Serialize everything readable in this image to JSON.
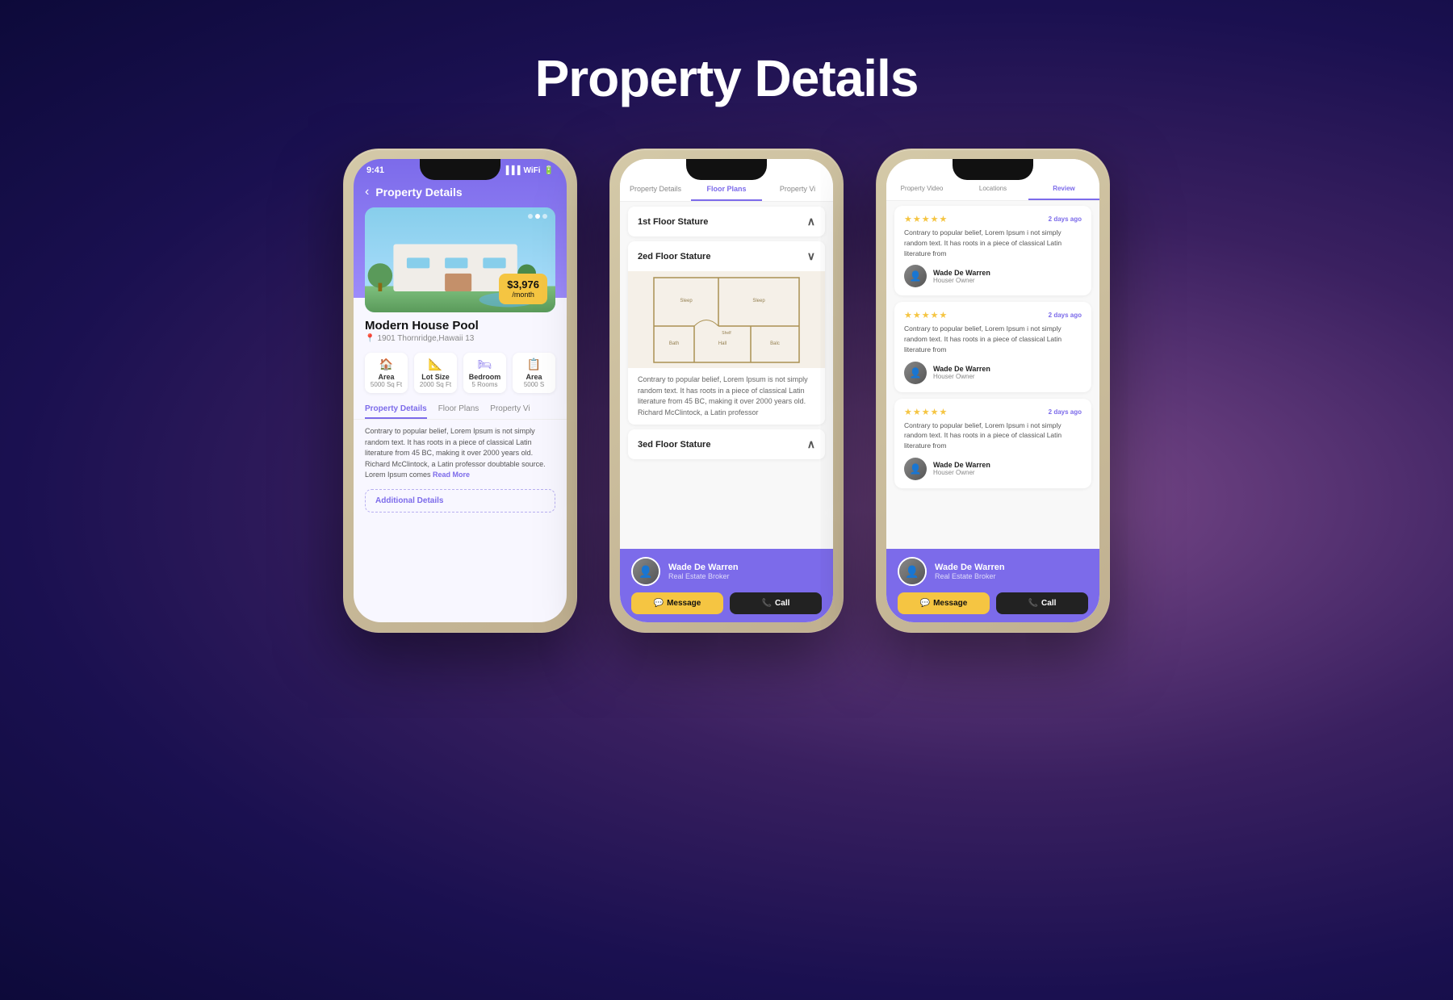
{
  "page": {
    "title": "Property Details",
    "background": "radial-gradient purple"
  },
  "phone1": {
    "status_time": "9:41",
    "header_title": "Property Details",
    "back_label": "‹",
    "property_name": "Modern House Pool",
    "property_address": "1901 Thornridge,Hawaii 13",
    "price": "$3,976",
    "price_period": "/month",
    "stats": [
      {
        "icon": "🏠",
        "label": "Area",
        "value": "5000 Sq Ft"
      },
      {
        "icon": "📐",
        "label": "Lot Size",
        "value": "2000 Sq Ft"
      },
      {
        "icon": "🛏",
        "label": "Bedroom",
        "value": "5 Rooms"
      },
      {
        "icon": "📋",
        "label": "Area",
        "value": "5000 S"
      }
    ],
    "tabs": [
      "Property Details",
      "Floor Plans",
      "Property Vi"
    ],
    "active_tab": "Property Details",
    "description": "Contrary to popular belief, Lorem Ipsum is not simply random text. It has roots in a piece of classical Latin literature from 45 BC, making it over 2000 years old. Richard McClintock, a Latin professor doubtable source. Lorem Ipsum comes",
    "read_more": "Read More",
    "additional_details": "Additional Details"
  },
  "phone2": {
    "tabs": [
      "Property Details",
      "Floor Plans",
      "Property Vi"
    ],
    "active_tab": "Floor Plans",
    "floors": [
      {
        "label": "1st Floor Stature",
        "expanded": false,
        "icon": "∧"
      },
      {
        "label": "2ed Floor Stature",
        "expanded": true,
        "icon": "∨",
        "description": "Contrary to popular belief, Lorem Ipsum is not simply random text. It has roots in a piece of classical Latin literature from 45 BC, making it over 2000 years old. Richard McClintock, a Latin professor"
      },
      {
        "label": "3ed Floor Stature",
        "expanded": false,
        "icon": "∧"
      }
    ],
    "agent_name": "Wade De Warren",
    "agent_role": "Real Estate Broker",
    "message_label": "Message",
    "call_label": "Call"
  },
  "phone3": {
    "tabs": [
      "Property Video",
      "Locations",
      "Review"
    ],
    "active_tab": "Review",
    "reviews": [
      {
        "stars": "★★★★★",
        "date": "2 days ago",
        "text": "Contrary to popular belief, Lorem Ipsum i not simply random text. It has roots in a piece of classical Latin literature from",
        "reviewer_name": "Wade De Warren",
        "reviewer_role": "Houser Owner"
      },
      {
        "stars": "★★★★★",
        "date": "2 days ago",
        "text": "Contrary to popular belief, Lorem Ipsum i not simply random text. It has roots in a piece of classical Latin literature from",
        "reviewer_name": "Wade De Warren",
        "reviewer_role": "Houser Owner"
      },
      {
        "stars": "★★★★★",
        "date": "2 days ago",
        "text": "Contrary to popular belief, Lorem Ipsum i not simply random text. It has roots in a piece of classical Latin literature from",
        "reviewer_name": "Wade De Warren",
        "reviewer_role": "Houser Owner"
      }
    ],
    "agent_name": "Wade De Warren",
    "agent_role": "Real Estate Broker",
    "message_label": "Message",
    "call_label": "Call"
  }
}
